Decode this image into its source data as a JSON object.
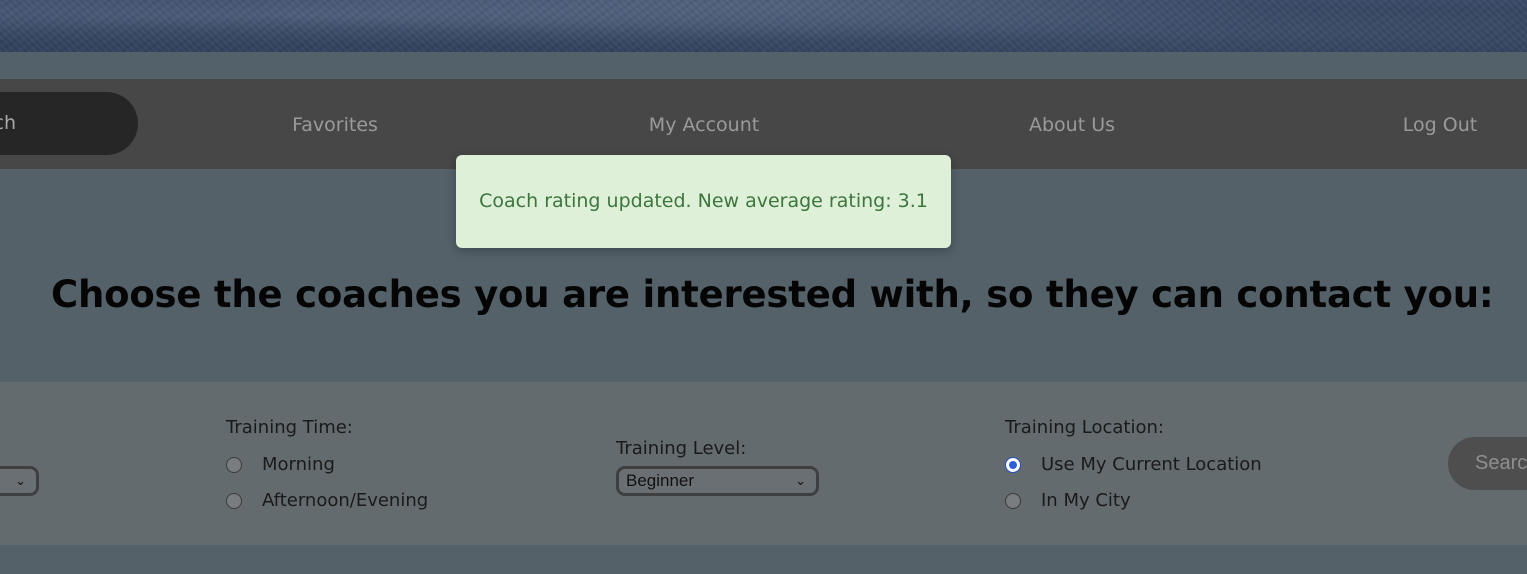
{
  "nav": {
    "search_label": "Search",
    "items": [
      {
        "label": "Favorites"
      },
      {
        "label": "My Account"
      },
      {
        "label": "About Us"
      },
      {
        "label": "Log Out"
      }
    ]
  },
  "toast": {
    "message": "Coach rating updated. New average rating: 3.1"
  },
  "main": {
    "heading": "Choose the coaches you are interested with, so they can contact you:"
  },
  "filters": {
    "training_time": {
      "label": "Training Time:",
      "options": [
        {
          "label": "Morning",
          "checked": false
        },
        {
          "label": "Afternoon/Evening",
          "checked": false
        }
      ]
    },
    "training_level": {
      "label": "Training Level:",
      "selected": "Beginner"
    },
    "training_location": {
      "label": "Training Location:",
      "options": [
        {
          "label": "Use My Current Location",
          "checked": true
        },
        {
          "label": "In My City",
          "checked": false
        }
      ]
    },
    "search_button": "Search"
  },
  "colors": {
    "nav_background": "#474747",
    "toast_background": "#dff0d8",
    "toast_text": "#3c763d",
    "radio_checked": "#2e5fd6"
  }
}
